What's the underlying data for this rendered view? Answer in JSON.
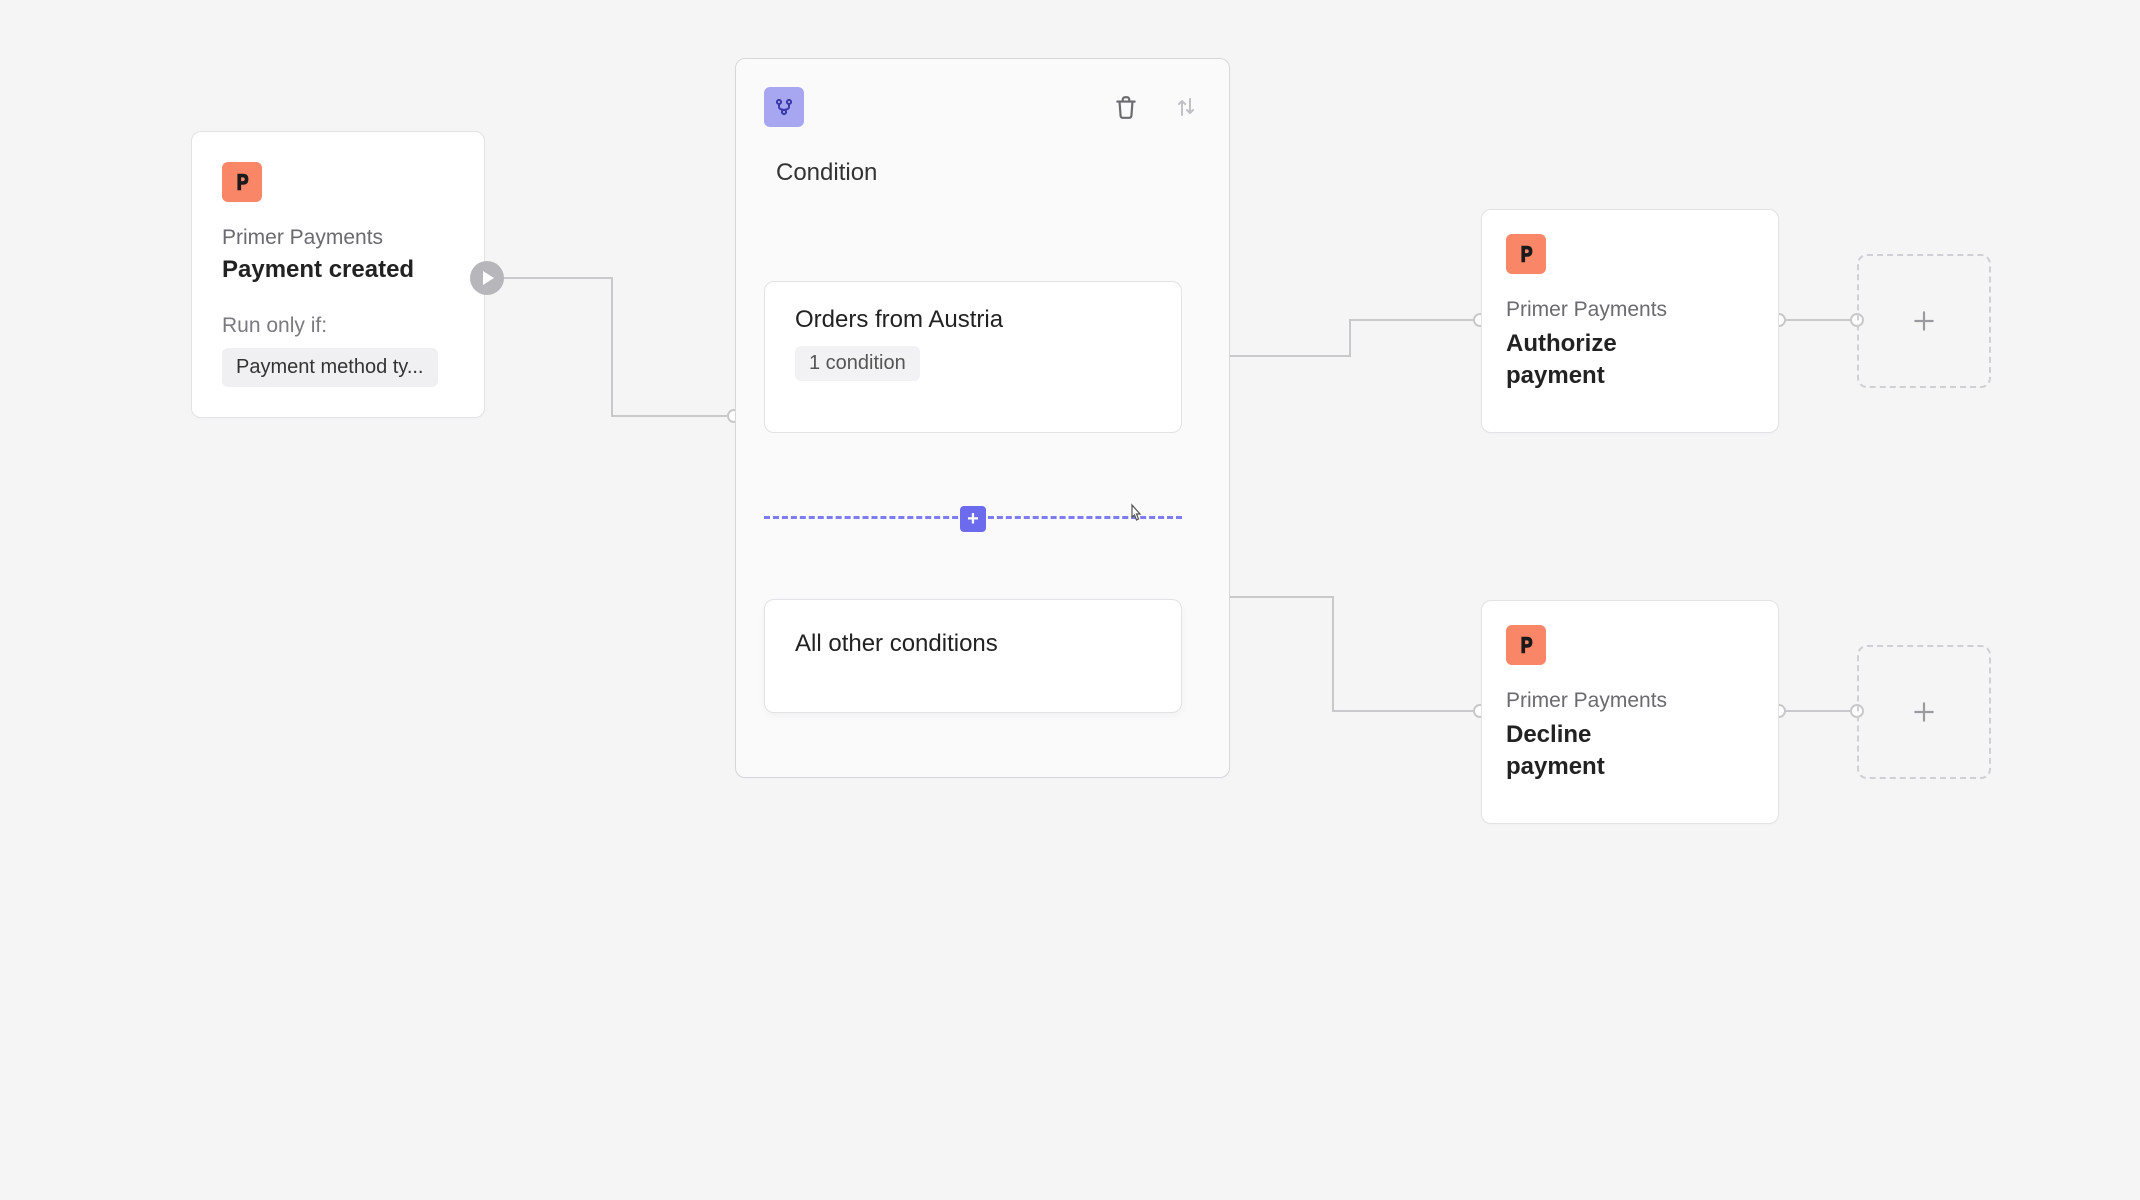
{
  "trigger": {
    "provider": "Primer Payments",
    "event": "Payment created",
    "run_if_label": "Run only if:",
    "chip": "Payment method ty..."
  },
  "condition": {
    "title": "Condition",
    "branches": [
      {
        "name": "Orders from Austria",
        "count_label": "1 condition"
      },
      {
        "name": "All other conditions"
      }
    ],
    "insert_label": "+"
  },
  "actions": [
    {
      "provider": "Primer Payments",
      "name": "Authorize payment"
    },
    {
      "provider": "Primer Payments",
      "name": "Decline payment"
    }
  ],
  "colors": {
    "logo_bg": "#FA8668",
    "condition_badge_bg": "#A7A6F0",
    "insert_accent": "#6C6BED"
  }
}
